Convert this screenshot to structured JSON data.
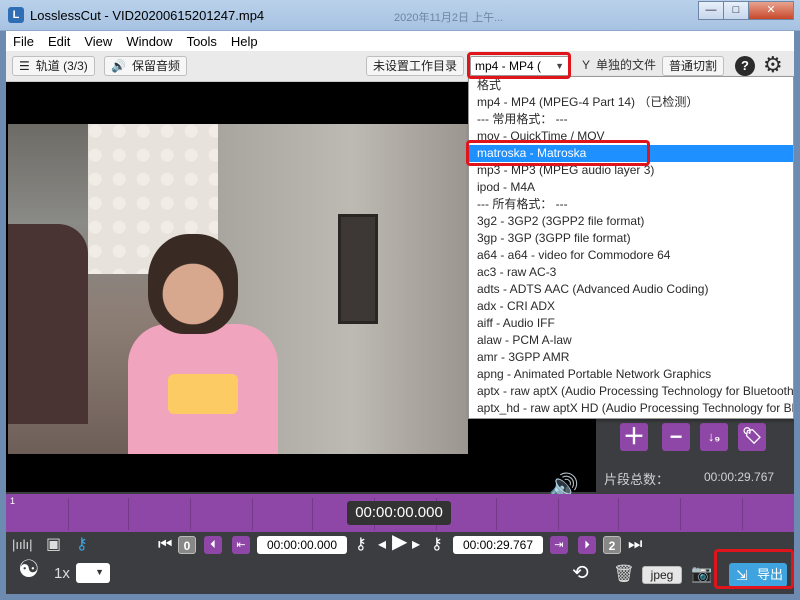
{
  "window": {
    "title": "LosslessCut - VID20200615201247.mp4",
    "ghost_text": "2020年11月2日  上午...",
    "app_glyph": "L",
    "minimize": "—",
    "maximize": "□",
    "close": "✕"
  },
  "menu": [
    "File",
    "Edit",
    "View",
    "Window",
    "Tools",
    "Help"
  ],
  "toolbar": {
    "tracks": "轨道 (3/3)",
    "keep_audio": "保留音频",
    "workdir": "未设置工作目录",
    "format_value": "mp4 - MP4 (",
    "separate_files": "单独的文件",
    "normal_cut": "普通切割",
    "help": "?"
  },
  "format_options": [
    "格式",
    "mp4 - MP4 (MPEG-4 Part 14) （已检测）",
    "--- 常用格式： ---",
    "mov - QuickTime / MOV",
    "matroska - Matroska",
    "mp3 - MP3 (MPEG audio layer 3)",
    "ipod - M4A",
    "--- 所有格式： ---",
    "3g2 - 3GP2 (3GPP2 file format)",
    "3gp - 3GP (3GPP file format)",
    "a64 - a64 - video for Commodore 64",
    "ac3 - raw AC-3",
    "adts - ADTS AAC (Advanced Audio Coding)",
    "adx - CRI ADX",
    "aiff - Audio IFF",
    "alaw - PCM A-law",
    "amr - 3GPP AMR",
    "apng - Animated Portable Network Graphics",
    "aptx - raw aptX (Audio Processing Technology for Bluetooth)",
    "aptx_hd - raw aptX HD (Audio Processing Technology for Blue"
  ],
  "highlighted_option_index": 4,
  "segments": {
    "total_label": "片段总数：",
    "total_value": "00:00:29.767",
    "sort_glyph": "↓₉"
  },
  "timeline": {
    "current_time": "00:00:00.000",
    "marker": "1"
  },
  "controls": {
    "start_time": "00:00:00.000",
    "end_time": "00:00:29.767",
    "start_seg_num": "0",
    "end_seg_num": "2",
    "speed": "1x",
    "screenshot_format": "jpeg",
    "export": "导出"
  },
  "colors": {
    "accent_purple": "#8e46a7",
    "highlight_blue": "#1e90ff",
    "annotation_red": "#e0141b",
    "export_blue": "#3fa3e0"
  }
}
